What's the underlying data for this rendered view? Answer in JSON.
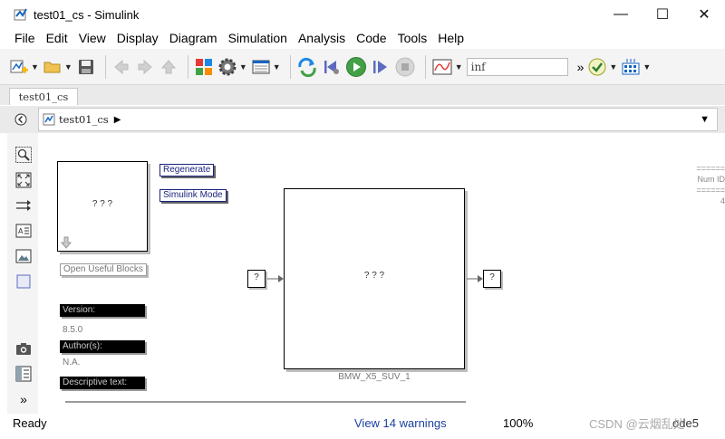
{
  "window": {
    "title": "test01_cs - Simulink",
    "minimize_glyph": "—",
    "maximize_glyph": "☐",
    "close_glyph": "✕"
  },
  "menu": [
    "File",
    "Edit",
    "View",
    "Display",
    "Diagram",
    "Simulation",
    "Analysis",
    "Code",
    "Tools",
    "Help"
  ],
  "toolbar": {
    "stop_time": "inf",
    "overflow": "»"
  },
  "tab": {
    "label": "test01_cs"
  },
  "breadcrumb": {
    "model": "test01_cs"
  },
  "canvas": {
    "subsystem_label": "? ? ?",
    "regenerate_label": "Regenerate",
    "simulink_mode_label": "Simulink Mode",
    "open_useful_blocks_label": "Open Useful Blocks",
    "version_label": "Version:",
    "version_value": "8.5.0",
    "authors_label": "Author(s):",
    "authors_value": "N.A.",
    "description_label": "Descriptive text:",
    "main_block_label": "? ? ?",
    "main_block_name": "BMW_X5_SUV_1",
    "inport_label": "?",
    "outport_label": "?",
    "annotation_line1": "======",
    "annotation_line2": "Num ID",
    "annotation_line3": "======",
    "annotation_line4": "4"
  },
  "status": {
    "ready": "Ready",
    "warnings": "View 14 warnings",
    "zoom": "100%",
    "solver": "ode5"
  },
  "watermark": "CSDN @云烟乱处"
}
